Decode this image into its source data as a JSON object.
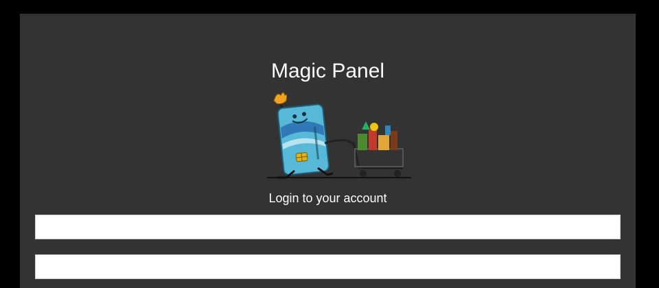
{
  "app": {
    "title": "Magic Panel",
    "subtitle": "Login to your account"
  },
  "form": {
    "username": {
      "value": "",
      "placeholder": ""
    },
    "password": {
      "value": "",
      "placeholder": ""
    }
  },
  "illustration": {
    "icon": "credit-card-mascot-with-shopping-cart"
  },
  "colors": {
    "page_background": "#000000",
    "panel_background": "#333333",
    "text": "#ffffff",
    "input_background": "#ffffff"
  }
}
